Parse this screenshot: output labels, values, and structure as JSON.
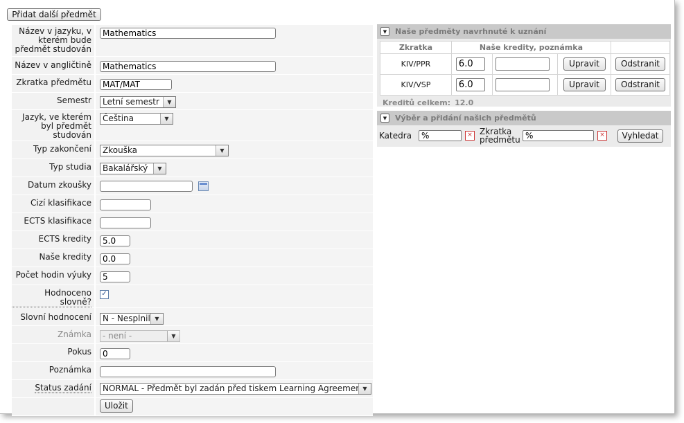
{
  "add_button": "Přidat další předmět",
  "form": {
    "name_lang_label": "Název v jazyku, v kterém bude předmět studován",
    "name_lang_value": "Mathematics",
    "name_en_label": "Název v angličtině",
    "name_en_value": "Mathematics",
    "abbr_label": "Zkratka předmětu",
    "abbr_value": "MAT/MAT",
    "semester_label": "Semestr",
    "semester_value": "Letní semestr",
    "language_label": "Jazyk, ve kterém byl předmět studován",
    "language_value": "Čeština",
    "exam_type_label": "Typ zakončení",
    "exam_type_value": "Zkouška",
    "study_type_label": "Typ studia",
    "study_type_value": "Bakalářský",
    "exam_date_label": "Datum zkoušky",
    "exam_date_value": "",
    "foreign_grade_label": "Cizí klasifikace",
    "foreign_grade_value": "",
    "ects_grade_label": "ECTS klasifikace",
    "ects_grade_value": "",
    "ects_credits_label": "ECTS kredity",
    "ects_credits_value": "5.0",
    "our_credits_label": "Naše kredity",
    "our_credits_value": "0.0",
    "hours_label": "Počet hodin výuky",
    "hours_value": "5",
    "verbal_eval_label": "Hodnoceno slovně?",
    "verbal_eval_checked": true,
    "verbal_grade_label": "Slovní hodnocení",
    "verbal_grade_value": "N - Nesplnil",
    "grade_label": "Známka",
    "grade_value": "- není -",
    "attempt_label": "Pokus",
    "attempt_value": "0",
    "note_label": "Poznámka",
    "note_value": "",
    "status_label": "Status zadání",
    "status_value": "NORMAL - Předmět byl zadán před tiskem Learning Agreement",
    "save_button": "Uložit"
  },
  "recognized_panel": {
    "title": "Naše předměty navrhnuté k uznání",
    "col_abbr": "Zkratka",
    "col_credits": "Naše kredity, poznámka",
    "rows": [
      {
        "abbr": "KIV/PPR",
        "credits": "6.0",
        "note": "",
        "edit": "Upravit",
        "remove": "Odstranit"
      },
      {
        "abbr": "KIV/VSP",
        "credits": "6.0",
        "note": "",
        "edit": "Upravit",
        "remove": "Odstranit"
      }
    ],
    "total_label": "Kreditů celkem:",
    "total_value": "12.0"
  },
  "select_panel": {
    "title": "Výběr a přidání našich předmětů",
    "dept_label": "Katedra",
    "dept_value": "%",
    "abbr_label": "Zkratka předmětu",
    "abbr_value": "%",
    "search_button": "Vyhledat"
  }
}
